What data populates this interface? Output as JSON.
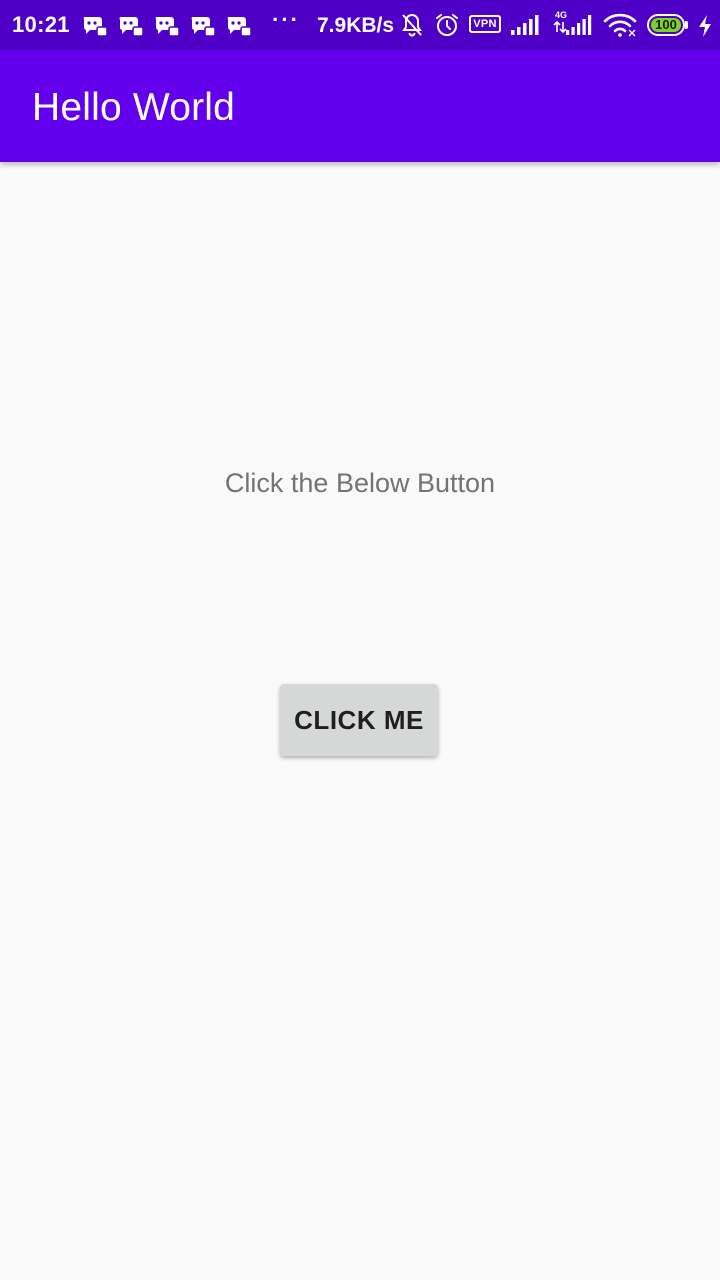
{
  "status_bar": {
    "time": "10:21",
    "overflow_indicator": "···",
    "network_speed": "7.9KB/s",
    "vpn_label": "VPN",
    "signal_type": "4G",
    "battery_level": "100",
    "notification_icons": [
      "chat-app-icon",
      "chat-app-icon",
      "chat-app-icon",
      "chat-app-icon",
      "chat-app-icon"
    ],
    "system_icons": [
      "bell-off-icon",
      "alarm-icon",
      "vpn-icon",
      "signal-icon",
      "signal-4g-icon",
      "wifi-icon",
      "battery-icon",
      "charging-icon"
    ],
    "background_color": "#4f00c6"
  },
  "app_bar": {
    "title": "Hello World",
    "background_color": "#6200ee"
  },
  "main": {
    "prompt_text": "Click the Below Button",
    "button_label": "CLICK ME"
  }
}
